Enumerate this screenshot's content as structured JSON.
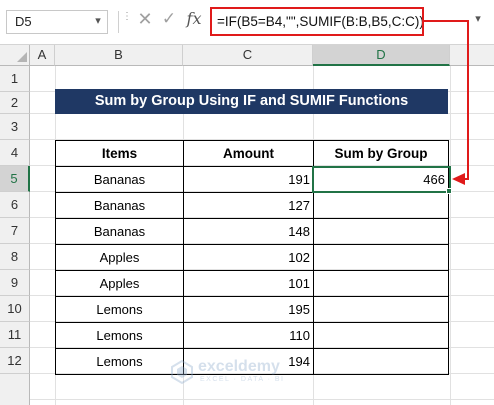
{
  "formula_bar": {
    "name_box": "D5",
    "formula": "=IF(B5=B4,\"\",SUMIF(B:B,B5,C:C))",
    "fx_label": "fx",
    "cancel_glyph": "✕",
    "enter_glyph": "✓"
  },
  "columns": [
    "A",
    "B",
    "C",
    "D"
  ],
  "rows": [
    "1",
    "2",
    "3",
    "4",
    "5",
    "6",
    "7",
    "8",
    "9",
    "10",
    "11",
    "12"
  ],
  "selected": {
    "column": "D",
    "row": "5"
  },
  "sheet": {
    "title": "Sum by Group Using IF and SUMIF Functions",
    "headers": {
      "items": "Items",
      "amount": "Amount",
      "sum_by_group": "Sum by Group"
    },
    "data": [
      {
        "item": "Bananas",
        "amount": "191",
        "sum": "466"
      },
      {
        "item": "Bananas",
        "amount": "127",
        "sum": ""
      },
      {
        "item": "Bananas",
        "amount": "148",
        "sum": ""
      },
      {
        "item": "Apples",
        "amount": "102",
        "sum": ""
      },
      {
        "item": "Apples",
        "amount": "101",
        "sum": ""
      },
      {
        "item": "Lemons",
        "amount": "195",
        "sum": ""
      },
      {
        "item": "Lemons",
        "amount": "110",
        "sum": ""
      },
      {
        "item": "Lemons",
        "amount": "194",
        "sum": ""
      }
    ]
  },
  "watermark": {
    "name": "exceldemy",
    "tagline": "EXCEL · DATA · BI"
  },
  "colors": {
    "title_bg": "#1f3864",
    "accent": "#217346",
    "highlight": "#e01a1a"
  }
}
